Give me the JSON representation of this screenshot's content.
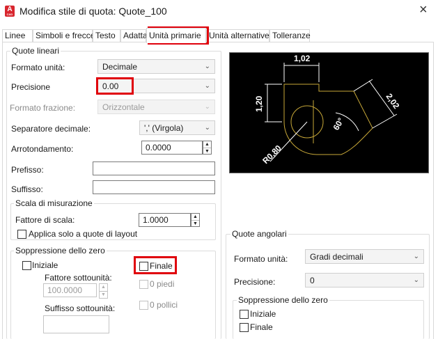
{
  "window": {
    "title": "Modifica stile di quota: Quote_100",
    "app_icon_letter": "A",
    "close_glyph": "×"
  },
  "tabs": [
    "Linee",
    "Simboli e frecce",
    "Testo",
    "Adatta",
    "Unità primarie",
    "Unità alternative",
    "Tolleranze"
  ],
  "active_tab": "Unità primarie",
  "linear": {
    "title": "Quote lineari",
    "unit_format_label": "Formato unità:",
    "unit_format_value": "Decimale",
    "precision_label": "Precisione",
    "precision_value": "0.00",
    "fraction_format_label": "Formato frazione:",
    "fraction_format_value": "Orizzontale",
    "decimal_sep_label": "Separatore decimale:",
    "decimal_sep_value": "',' (Virgola)",
    "roundoff_label": "Arrotondamento:",
    "roundoff_value": "0.0000",
    "prefix_label": "Prefisso:",
    "prefix_value": "",
    "suffix_label": "Suffisso:",
    "suffix_value": ""
  },
  "scale": {
    "title": "Scala di misurazione",
    "factor_label": "Fattore di scala:",
    "factor_value": "1.0000",
    "layout_only_label": "Applica solo a quote di layout"
  },
  "zero_suppression": {
    "title": "Soppressione dello zero",
    "leading_label": "Iniziale",
    "trailing_label": "Finale",
    "subunit_factor_label": "Fattore sottounità:",
    "subunit_factor_value": "100.0000",
    "feet_label": "0 piedi",
    "inches_label": "0 pollici",
    "subunit_suffix_label": "Suffisso sottounità:",
    "subunit_suffix_value": ""
  },
  "preview": {
    "dim_top": "1,02",
    "dim_left": "1,20",
    "dim_right": "2,02",
    "dim_angle": "60°",
    "dim_radius": "R0,80"
  },
  "angular": {
    "title": "Quote angolari",
    "unit_format_label": "Formato unità:",
    "unit_format_value": "Gradi decimali",
    "precision_label": "Precisione:",
    "precision_value": "0",
    "zero_title": "Soppressione dello zero",
    "leading_label": "Iniziale",
    "trailing_label": "Finale"
  },
  "colors": {
    "highlight": "#e0000b",
    "preview_bg": "#000000",
    "preview_geometry": "#c8a838",
    "preview_text": "#ffffff"
  }
}
